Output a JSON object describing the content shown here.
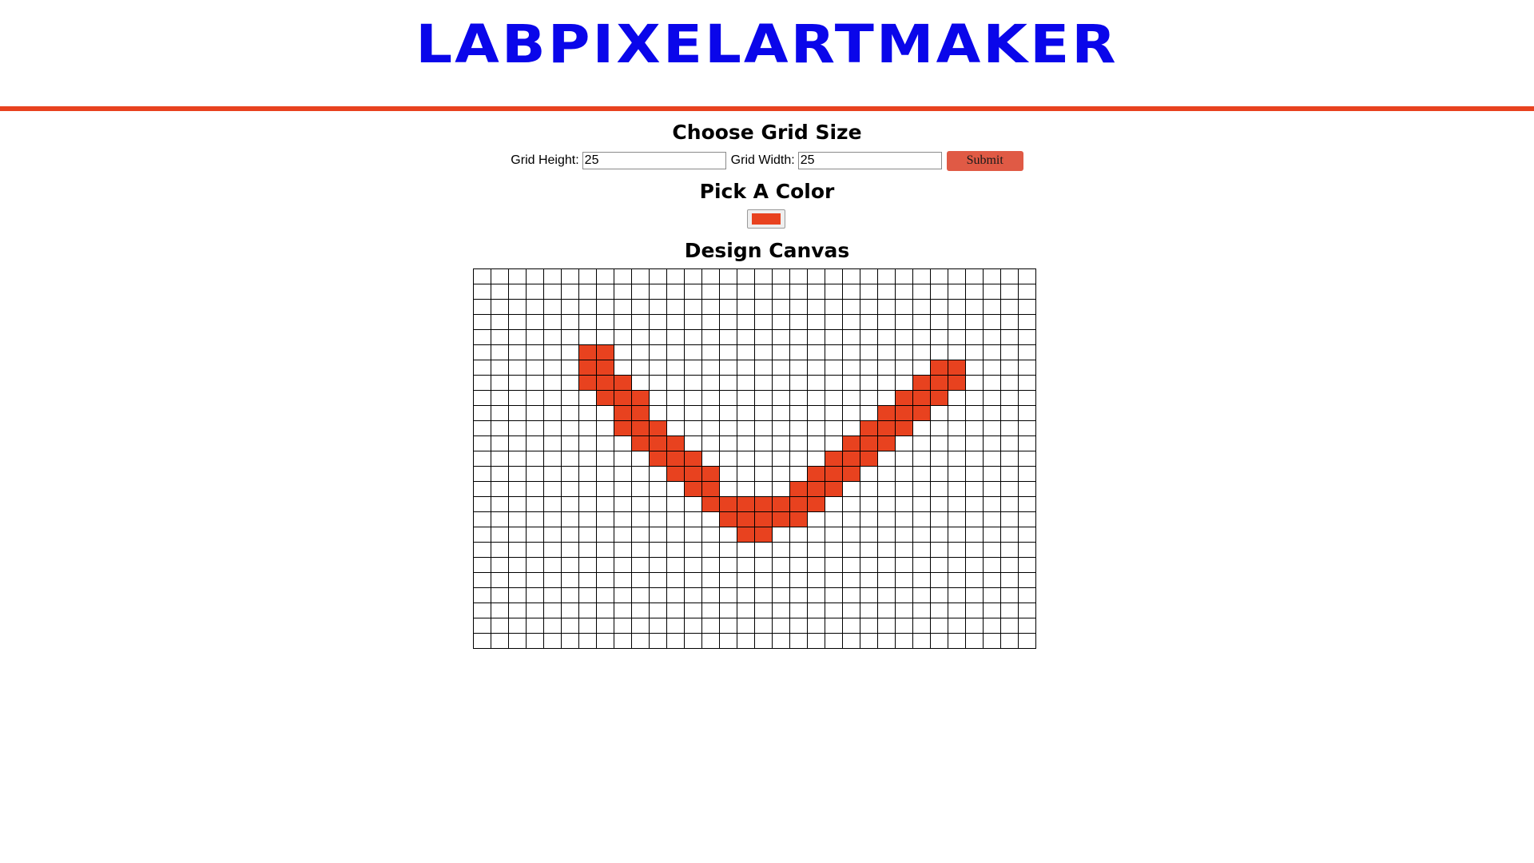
{
  "app": {
    "title": "LABPIXELARTMAKER"
  },
  "grid_size": {
    "heading": "Choose Grid Size",
    "height_label": "Grid Height:",
    "height_value": "25",
    "width_label": "Grid Width:",
    "width_value": "25",
    "submit_label": "Submit"
  },
  "color_section": {
    "heading": "Pick A Color",
    "selected_color": "#e8421f"
  },
  "canvas": {
    "heading": "Design Canvas",
    "rows": 25,
    "cols": 32,
    "fill_color": "#e8421f",
    "filled_cells": [
      [
        5,
        6
      ],
      [
        5,
        7
      ],
      [
        6,
        6
      ],
      [
        6,
        7
      ],
      [
        6,
        26
      ],
      [
        6,
        27
      ],
      [
        7,
        6
      ],
      [
        7,
        7
      ],
      [
        7,
        8
      ],
      [
        7,
        25
      ],
      [
        7,
        26
      ],
      [
        7,
        27
      ],
      [
        8,
        7
      ],
      [
        8,
        8
      ],
      [
        8,
        9
      ],
      [
        8,
        24
      ],
      [
        8,
        25
      ],
      [
        8,
        26
      ],
      [
        9,
        8
      ],
      [
        9,
        9
      ],
      [
        9,
        23
      ],
      [
        9,
        24
      ],
      [
        9,
        25
      ],
      [
        10,
        8
      ],
      [
        10,
        9
      ],
      [
        10,
        10
      ],
      [
        10,
        22
      ],
      [
        10,
        23
      ],
      [
        10,
        24
      ],
      [
        11,
        9
      ],
      [
        11,
        10
      ],
      [
        11,
        11
      ],
      [
        11,
        21
      ],
      [
        11,
        22
      ],
      [
        11,
        23
      ],
      [
        12,
        10
      ],
      [
        12,
        11
      ],
      [
        12,
        12
      ],
      [
        12,
        20
      ],
      [
        12,
        21
      ],
      [
        12,
        22
      ],
      [
        13,
        11
      ],
      [
        13,
        12
      ],
      [
        13,
        13
      ],
      [
        13,
        19
      ],
      [
        13,
        20
      ],
      [
        13,
        21
      ],
      [
        14,
        12
      ],
      [
        14,
        13
      ],
      [
        14,
        18
      ],
      [
        14,
        19
      ],
      [
        14,
        20
      ],
      [
        15,
        13
      ],
      [
        15,
        14
      ],
      [
        15,
        15
      ],
      [
        15,
        16
      ],
      [
        15,
        17
      ],
      [
        15,
        18
      ],
      [
        15,
        19
      ],
      [
        16,
        14
      ],
      [
        16,
        15
      ],
      [
        16,
        16
      ],
      [
        16,
        17
      ],
      [
        16,
        18
      ],
      [
        17,
        15
      ],
      [
        17,
        16
      ]
    ]
  }
}
